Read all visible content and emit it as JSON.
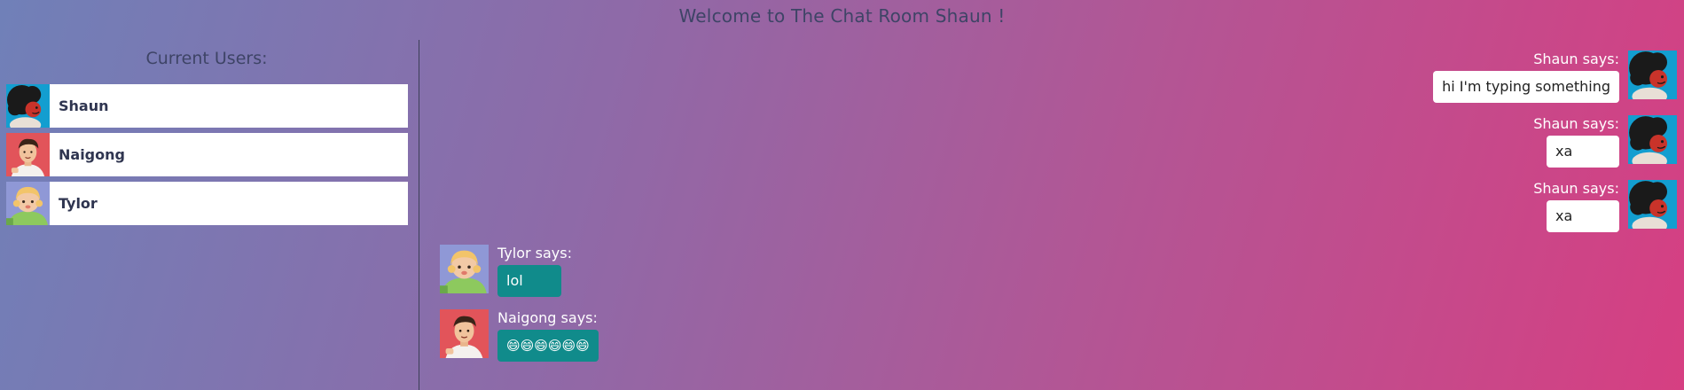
{
  "header": {
    "title": "Welcome to The Chat Room Shaun !"
  },
  "sidebar": {
    "heading": "Current Users:",
    "users": [
      {
        "name": "Shaun"
      },
      {
        "name": "Naigong"
      },
      {
        "name": "Tylor"
      }
    ]
  },
  "messages": [
    {
      "sender_label": "Shaun says:",
      "text": "hi I'm typing something"
    },
    {
      "sender_label": "Shaun says:",
      "text": "xa"
    },
    {
      "sender_label": "Shaun says:",
      "text": "xa"
    },
    {
      "sender_label": "Tylor says:",
      "text": "lol"
    },
    {
      "sender_label": "Naigong says:",
      "text": "😄😄😄😄😄😄"
    }
  ],
  "colors": {
    "gradient_start": "#7080b8",
    "gradient_end": "#d63f82",
    "others_bubble": "#108b8b",
    "own_bubble": "#ffffff",
    "heading_text": "#3e4466"
  },
  "icons": {
    "shaun": "avatar-afro-icon",
    "naigong": "avatar-man-icon",
    "tylor": "avatar-blonde-icon"
  }
}
